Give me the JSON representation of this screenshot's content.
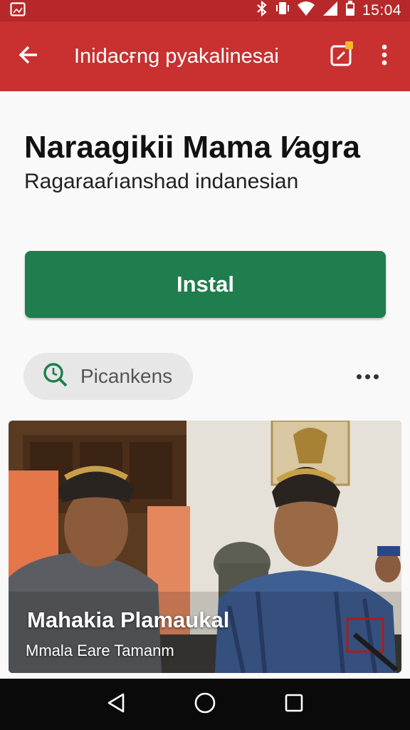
{
  "status_bar": {
    "time": "15:04",
    "icons": [
      "gallery-icon",
      "bluetooth-icon",
      "vibrate-icon",
      "wifi-icon",
      "signal-icon",
      "battery-icon"
    ]
  },
  "app_bar": {
    "title": "Inidacғng pyakalinesai",
    "icons": [
      "back-arrow-icon",
      "edit-note-icon",
      "more-vertical-icon"
    ],
    "color": "#c8312f",
    "badge_color": "#f6b92b"
  },
  "app": {
    "name": "Naraagikii Mama I⁄agra",
    "developer": "Ragaraaŕıanshad indanesian",
    "install_label": "Instal",
    "install_color": "#1f7d4e"
  },
  "chip": {
    "label": "Picankens",
    "icon": "search-clock-icon"
  },
  "screenshot": {
    "title": "Mahakia Plamaukal",
    "subtitle": "Mmala Eare Tamanm"
  },
  "nav_bar": {
    "icons": [
      "back-triangle-icon",
      "home-circle-icon",
      "recents-square-icon"
    ]
  }
}
